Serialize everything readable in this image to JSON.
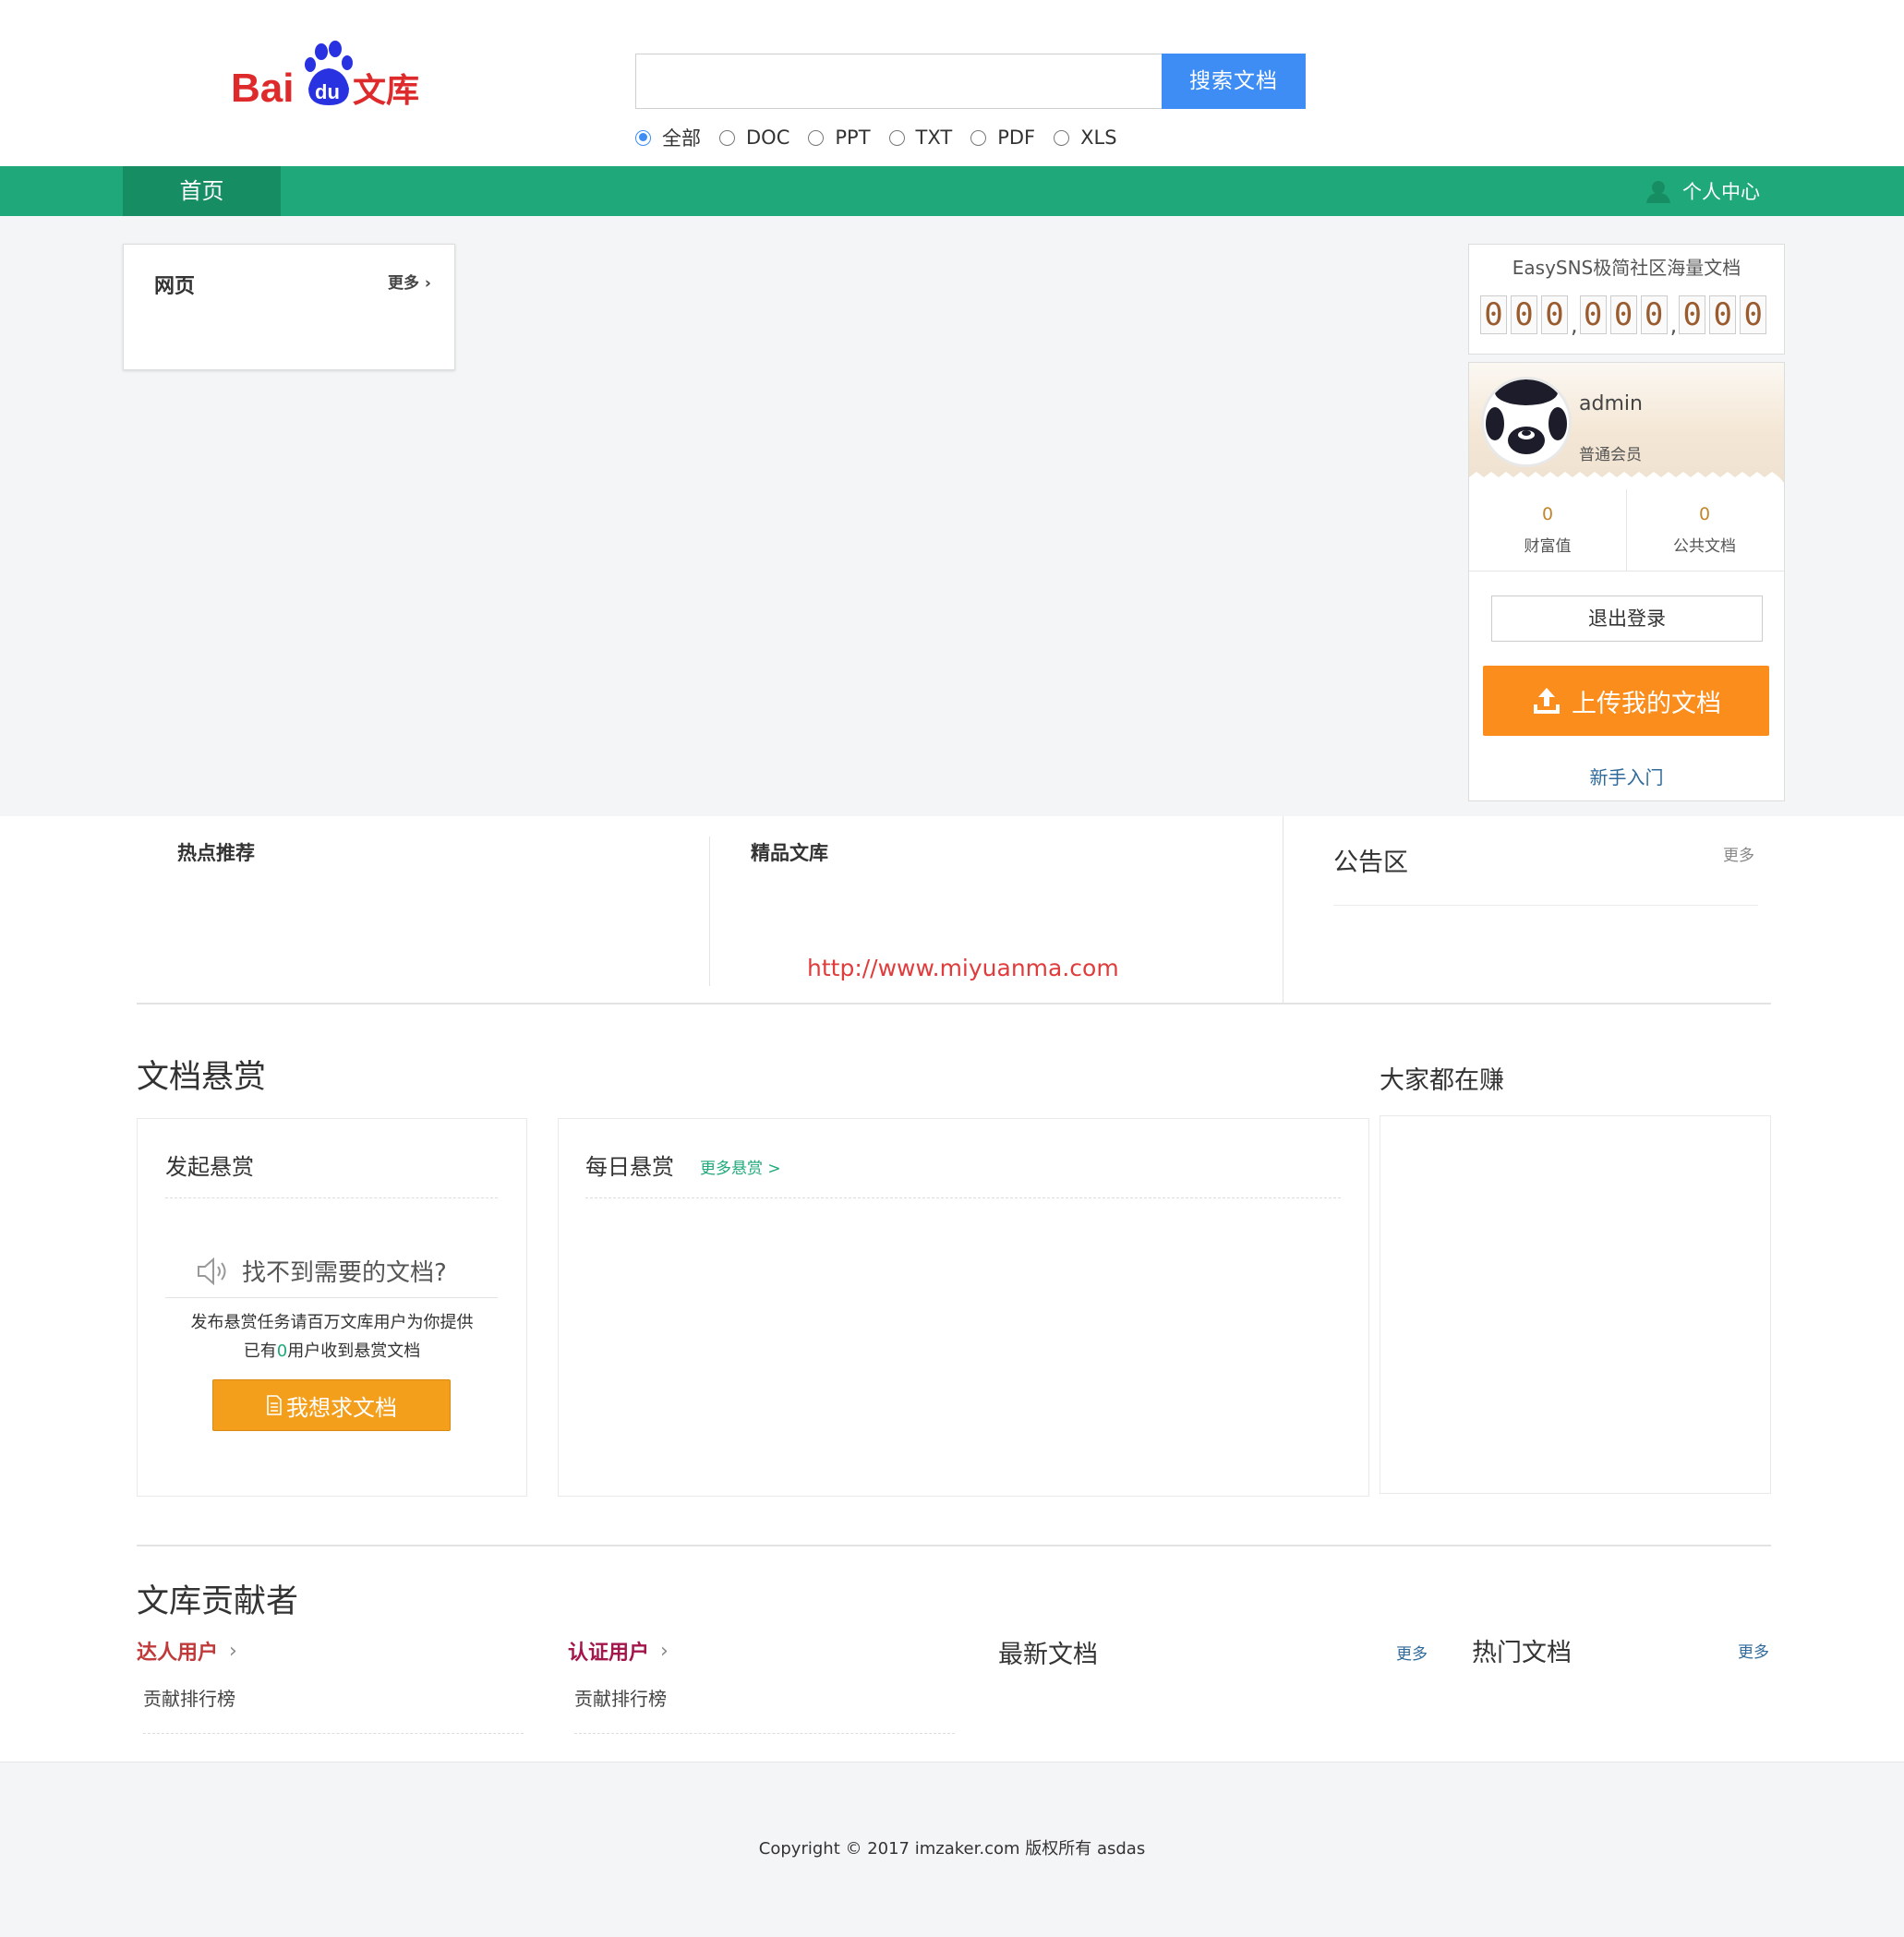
{
  "header": {
    "logo_text_bai": "Bai",
    "logo_text_du": "du",
    "logo_text_wenku": "文库",
    "search_placeholder": "",
    "search_button": "搜索文档",
    "filters": [
      {
        "label": "全部",
        "checked": true
      },
      {
        "label": "DOC",
        "checked": false
      },
      {
        "label": "PPT",
        "checked": false
      },
      {
        "label": "TXT",
        "checked": false
      },
      {
        "label": "PDF",
        "checked": false
      },
      {
        "label": "XLS",
        "checked": false
      }
    ]
  },
  "nav": {
    "home": "首页",
    "user_center": "个人中心"
  },
  "web_card": {
    "title": "网页",
    "more": "更多 ›"
  },
  "stats": {
    "title": "EasySNS极简社区海量文档",
    "digits": [
      "0",
      "0",
      "0",
      "0",
      "0",
      "0",
      "0",
      "0",
      "0"
    ]
  },
  "user": {
    "name": "admin",
    "level": "普通会员",
    "wealth_value": "0",
    "wealth_label": "财富值",
    "public_docs_value": "0",
    "public_docs_label": "公共文档",
    "logout": "退出登录",
    "upload": "上传我的文档",
    "newbie": "新手入门"
  },
  "middle": {
    "hot": "热点推荐",
    "fine": "精品文库",
    "notice": "公告区",
    "notice_more": "更多",
    "watermark": "http://www.miyuanma.com"
  },
  "reward": {
    "title": "文档悬赏",
    "earn_title": "大家都在赚",
    "start_title": "发起悬赏",
    "cant_find": "找不到需要的文档?",
    "desc1": "发布悬赏任务请百万文库用户为你提供",
    "desc2_pre": "已有",
    "desc2_count": "0",
    "desc2_post": "用户收到悬赏文档",
    "want_button": "我想求文档",
    "daily_title": "每日悬赏",
    "daily_more": "更多悬赏 >"
  },
  "contributors": {
    "title": "文库贡献者",
    "daren": "达人用户",
    "renzheng": "认证用户",
    "chevron": "›",
    "rank1": "贡献排行榜",
    "rank2": "贡献排行榜",
    "latest": "最新文档",
    "latest_more": "更多",
    "hotdoc": "热门文档",
    "hotdoc_more": "更多"
  },
  "footer": {
    "copyright": "Copyright © 2017 imzaker.com 版权所有 asdas"
  },
  "colors": {
    "nav_green": "#1fa97b",
    "search_blue": "#3d8df5",
    "upload_orange": "#fb8d1c",
    "want_orange": "#f49f1c"
  }
}
